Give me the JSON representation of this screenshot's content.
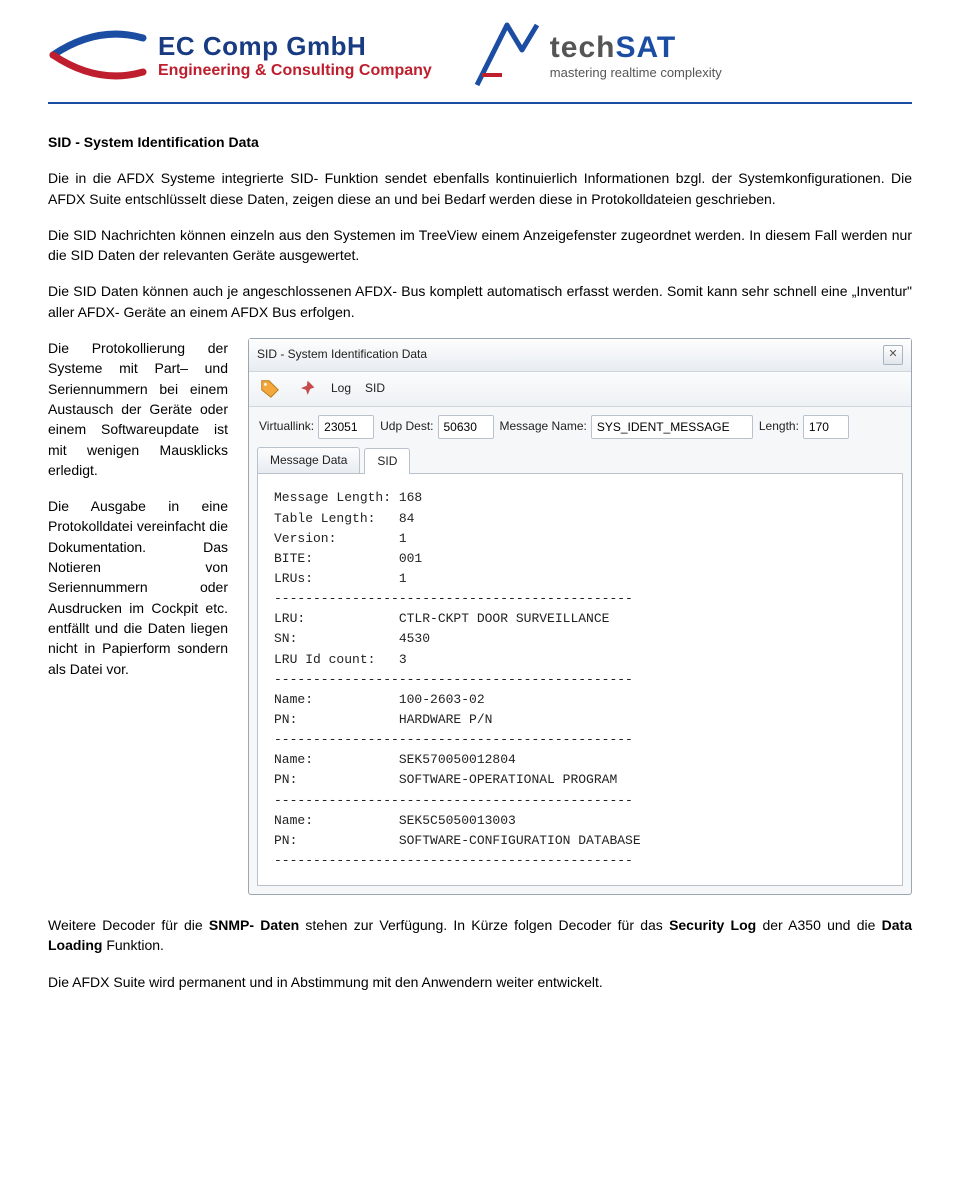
{
  "header": {
    "logo_ec": {
      "name": "EC Comp GmbH",
      "sub": "Engineering & Consulting Company"
    },
    "logo_techsat": {
      "name_tech": "tech",
      "name_sat": "SAT",
      "sub": "mastering realtime complexity"
    }
  },
  "heading": "SID - System Identification Data",
  "paragraphs": {
    "p1": "Die in die AFDX Systeme integrierte SID- Funktion sendet ebenfalls kontinuierlich Informationen bzgl. der Systemkonfigurationen. Die AFDX Suite entschlüsselt diese Daten, zeigen diese an und bei Bedarf werden diese in Protokolldateien geschrieben.",
    "p2": "Die SID Nachrichten können einzeln aus den Systemen im TreeView einem Anzeigefenster zugeordnet werden. In diesem Fall werden nur die SID Daten der relevanten Geräte ausgewertet.",
    "p3": "Die SID Daten können auch je angeschlossenen AFDX- Bus komplett automatisch erfasst werden. Somit kann sehr schnell eine „Inventur\" aller AFDX- Geräte an einem AFDX Bus erfolgen.",
    "left1": "Die Protokollierung der Systeme mit Part– und Seriennummern bei einem Austausch der Geräte oder einem Softwareupdate ist mit wenigen Mausklicks erledigt.",
    "left2": "Die Ausgabe in eine Protokolldatei vereinfacht die Dokumentation. Das Notieren von Seriennummern oder Ausdrucken im Cockpit etc. entfällt und die Daten liegen nicht in Papierform sondern als Datei vor."
  },
  "screenshot": {
    "title": "SID - System Identification Data",
    "toolbar": {
      "log_label": "Log",
      "sid_label": "SID"
    },
    "fields": {
      "virtuallink_label": "Virtuallink:",
      "virtuallink_value": "23051",
      "udpdest_label": "Udp Dest:",
      "udpdest_value": "50630",
      "msgname_label": "Message Name:",
      "msgname_value": "SYS_IDENT_MESSAGE",
      "length_label": "Length:",
      "length_value": "170"
    },
    "tabs": {
      "msgdata": "Message Data",
      "sid": "SID"
    },
    "body_lines": [
      "Message Length: 168",
      "Table Length:   84",
      "Version:        1",
      "BITE:           001",
      "LRUs:           1",
      "----------------------------------------------",
      "LRU:            CTLR-CKPT DOOR SURVEILLANCE",
      "SN:             4530",
      "LRU Id count:   3",
      "----------------------------------------------",
      "Name:           100-2603-02",
      "PN:             HARDWARE P/N",
      "----------------------------------------------",
      "Name:           SEK570050012804",
      "PN:             SOFTWARE-OPERATIONAL PROGRAM",
      "----------------------------------------------",
      "Name:           SEK5C5050013003",
      "PN:             SOFTWARE-CONFIGURATION DATABASE",
      "----------------------------------------------"
    ]
  },
  "footer": {
    "f1_pre": "Weitere Decoder für die ",
    "f1_b1": "SNMP- Daten",
    "f1_mid": " stehen zur Verfügung. In Kürze folgen Decoder für das ",
    "f1_b2": "Security Log",
    "f1_mid2": " der A350 und die ",
    "f1_b3": "Data Loading",
    "f1_post": " Funktion.",
    "f2": "Die AFDX Suite wird permanent und in Abstimmung mit den Anwendern weiter entwickelt."
  }
}
